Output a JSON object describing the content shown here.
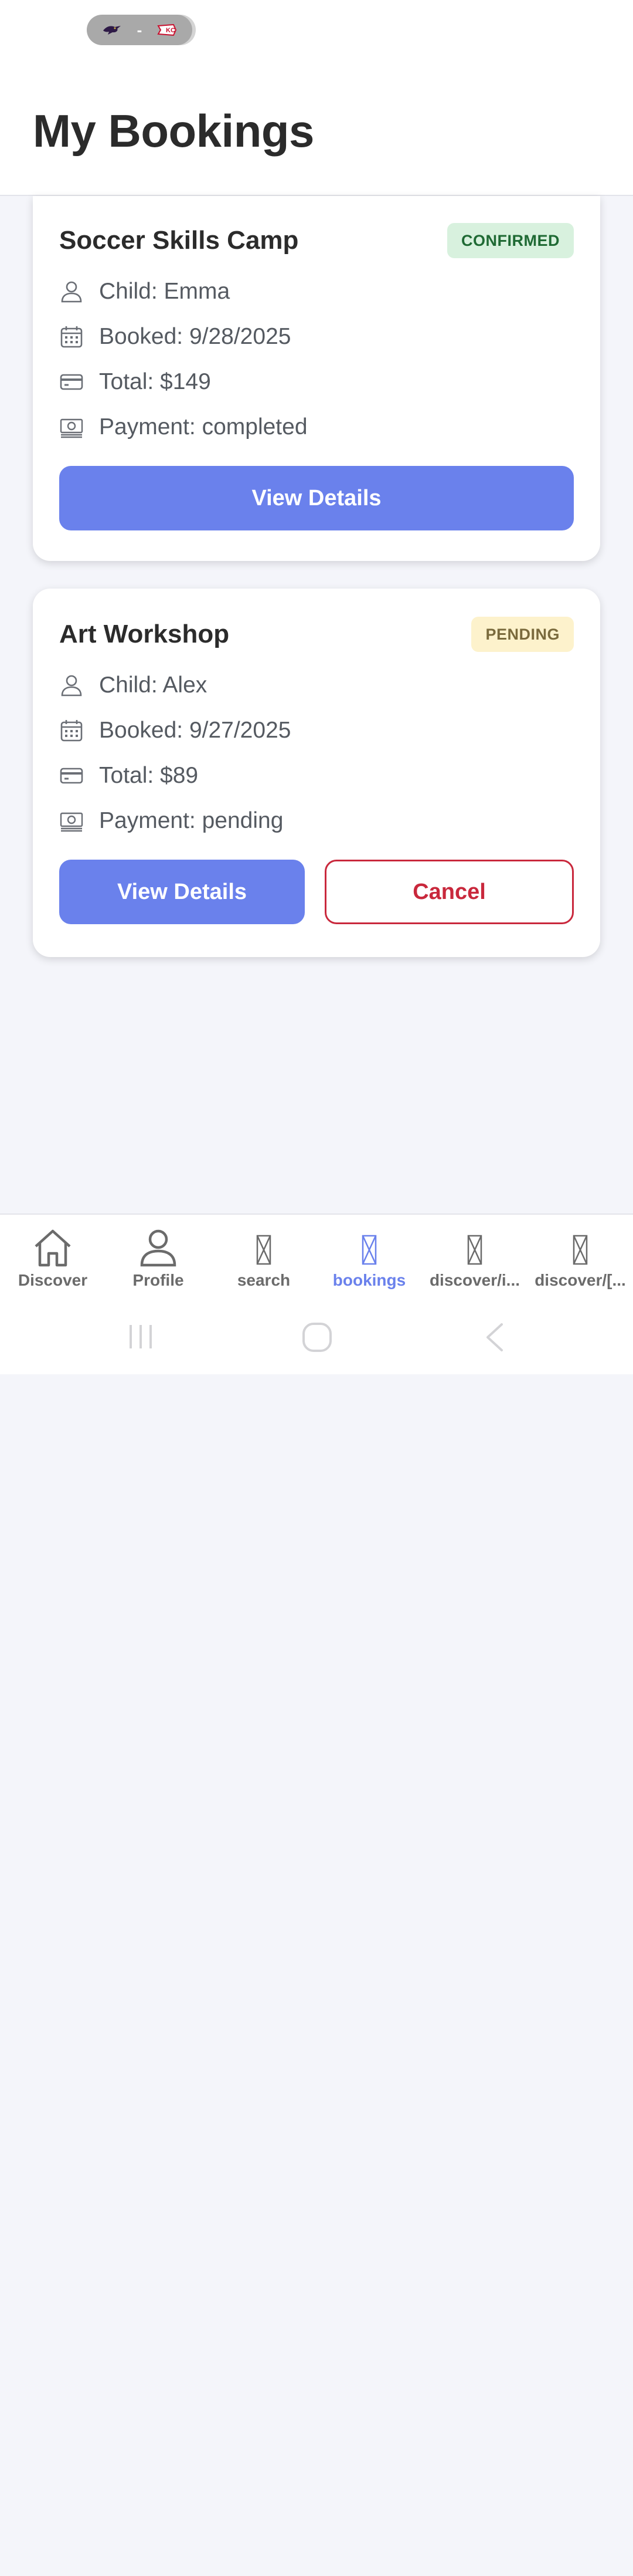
{
  "status_bar": {
    "score_separator": "-",
    "team_logos": [
      "ravens-logo-icon",
      "chiefs-logo-icon"
    ]
  },
  "header": {
    "title": "My Bookings"
  },
  "bookings": [
    {
      "title": "Soccer Skills Camp",
      "status": "CONFIRMED",
      "child": "Child: Emma",
      "booked": "Booked: 9/28/2025",
      "total": "Total: $149",
      "payment": "Payment: completed",
      "actions": {
        "view": "View Details"
      }
    },
    {
      "title": "Art Workshop",
      "status": "PENDING",
      "child": "Child: Alex",
      "booked": "Booked: 9/27/2025",
      "total": "Total: $89",
      "payment": "Payment: pending",
      "actions": {
        "view": "View Details",
        "cancel": "Cancel"
      }
    }
  ],
  "bottom_nav": {
    "active": "bookings",
    "items": [
      {
        "label": "Discover",
        "icon": "home-icon"
      },
      {
        "label": "Profile",
        "icon": "person-icon"
      },
      {
        "label": "search",
        "icon": "missing-glyph-icon"
      },
      {
        "label": "bookings",
        "icon": "missing-glyph-icon"
      },
      {
        "label": "discover/i...",
        "icon": "missing-glyph-icon"
      },
      {
        "label": "discover/[...",
        "icon": "missing-glyph-icon"
      }
    ]
  },
  "system_nav": [
    "recents-icon",
    "home-icon",
    "back-icon"
  ],
  "colors": {
    "accent": "#6a81ec",
    "confirmed_bg": "#d8f1de",
    "confirmed_text": "#1f6a34",
    "pending_bg": "#fdf2cc",
    "pending_text": "#7a6a3c",
    "cancel": "#c9283c",
    "background": "#f4f5fa"
  }
}
